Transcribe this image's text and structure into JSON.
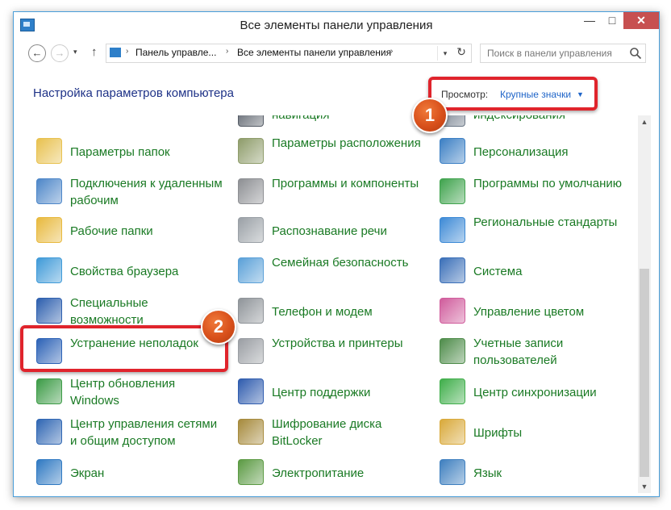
{
  "window": {
    "title": "Все элементы панели управления",
    "minimize": "—",
    "maximize": "□",
    "close": "✕"
  },
  "nav": {
    "back": "←",
    "forward": "→",
    "dropdown": "▾",
    "up": "↑"
  },
  "address": {
    "crumb1": "Панель управле...",
    "crumb2": "Все элементы панели управления",
    "sep": "›",
    "dropdown": "▾",
    "refresh": "↻"
  },
  "search": {
    "placeholder": "Поиск в панели управления"
  },
  "header": {
    "title": "Настройка параметров компьютера",
    "view_label": "Просмотр:",
    "view_value": "Крупные значки",
    "view_arrow": "▼"
  },
  "badges": {
    "one": "1",
    "two": "2"
  },
  "items": [
    {
      "label": "навигация",
      "icon": "navigation-icon",
      "color": "#555c66"
    },
    {
      "label": "индексирования",
      "icon": "indexing-icon",
      "color": "#6b7786"
    },
    {
      "label": "Параметры папок",
      "icon": "folder-options-icon",
      "color": "#e8c14f"
    },
    {
      "label": "Параметры расположения",
      "icon": "location-icon",
      "color": "#8e9c6a"
    },
    {
      "label": "Персонализация",
      "icon": "personalization-icon",
      "color": "#3b7fc4"
    },
    {
      "label": "Подключения к удаленным рабочим",
      "icon": "remote-desktop-icon",
      "color": "#4d86c8"
    },
    {
      "label": "Программы и компоненты",
      "icon": "programs-icon",
      "color": "#8d8f93"
    },
    {
      "label": "Программы по умолчанию",
      "icon": "default-programs-icon",
      "color": "#3fa34d"
    },
    {
      "label": "Рабочие папки",
      "icon": "work-folders-icon",
      "color": "#e8b93e"
    },
    {
      "label": "Распознавание речи",
      "icon": "microphone-icon",
      "color": "#9aa0a6"
    },
    {
      "label": "Региональные стандарты",
      "icon": "region-icon",
      "color": "#3d8ad6"
    },
    {
      "label": "Свойства браузера",
      "icon": "internet-options-icon",
      "color": "#3f9ad8"
    },
    {
      "label": "Семейная безопасность",
      "icon": "family-safety-icon",
      "color": "#5aa0d8"
    },
    {
      "label": "Система",
      "icon": "system-icon",
      "color": "#3a6fb8"
    },
    {
      "label": "Специальные возможности",
      "icon": "accessibility-icon",
      "color": "#2d5fae"
    },
    {
      "label": "Телефон и модем",
      "icon": "phone-modem-icon",
      "color": "#8f9499"
    },
    {
      "label": "Управление цветом",
      "icon": "color-management-icon",
      "color": "#d05c9c"
    },
    {
      "label": "Устранение неполадок",
      "icon": "troubleshooting-icon",
      "color": "#2c62b6"
    },
    {
      "label": "Устройства и принтеры",
      "icon": "printer-icon",
      "color": "#9a9ea3"
    },
    {
      "label": "Учетные записи пользователей",
      "icon": "user-accounts-icon",
      "color": "#4e8c4a"
    },
    {
      "label": "Центр обновления Windows",
      "icon": "windows-update-icon",
      "color": "#3c9b46"
    },
    {
      "label": "Центр поддержки",
      "icon": "action-center-flag-icon",
      "color": "#2f5cae"
    },
    {
      "label": "Центр синхронизации",
      "icon": "sync-center-icon",
      "color": "#3fae4a"
    },
    {
      "label": "Центр управления сетями и общим доступом",
      "icon": "network-icon",
      "color": "#2f66b3"
    },
    {
      "label": "Шифрование диска BitLocker",
      "icon": "bitlocker-icon",
      "color": "#a68a3c"
    },
    {
      "label": "Шрифты",
      "icon": "fonts-icon",
      "color": "#d9a93a"
    },
    {
      "label": "Экран",
      "icon": "display-icon",
      "color": "#2f79c2"
    },
    {
      "label": "Электропитание",
      "icon": "power-options-icon",
      "color": "#5b9a43"
    },
    {
      "label": "Язык",
      "icon": "language-icon",
      "color": "#3e7fbf"
    }
  ]
}
